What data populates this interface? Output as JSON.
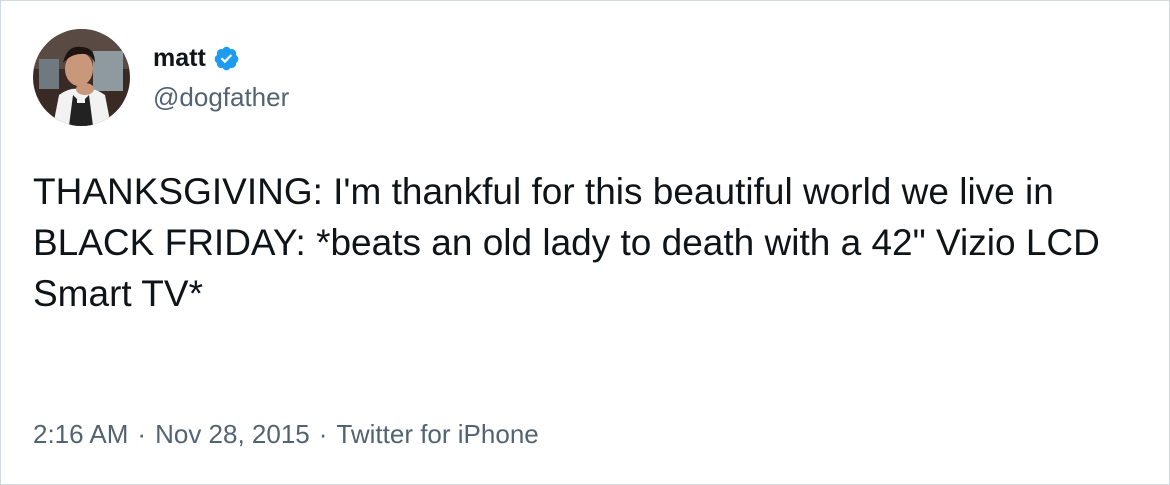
{
  "user": {
    "display_name": "matt",
    "handle": "@dogfather",
    "verified": true,
    "avatar_icon": "profile-photo-avatar",
    "verified_icon": "verified-badge-icon"
  },
  "tweet": {
    "text": "THANKSGIVING: I'm thankful for this beautiful world we live in\nBLACK FRIDAY: *beats an old lady to death with a 42\" Vizio LCD Smart TV*"
  },
  "meta": {
    "time": "2:16 AM",
    "separator": "·",
    "date": "Nov 28, 2015",
    "source": "Twitter for iPhone"
  },
  "colors": {
    "text": "#0f1419",
    "secondary": "#536471",
    "verified": "#1d9bf0",
    "border": "#cfd9de"
  }
}
